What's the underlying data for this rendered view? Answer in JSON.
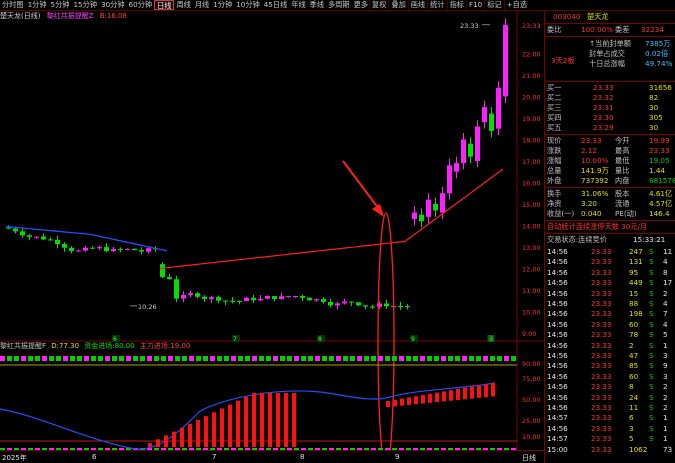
{
  "toolbar": {
    "left_items": [
      "分时图",
      "1分钟",
      "5分钟",
      "15分钟",
      "30分钟",
      "60分钟",
      "日线",
      "周线",
      "月线",
      "1分钟",
      "10分钟",
      "45日线",
      "年线",
      "季线",
      "多周期",
      "更多"
    ],
    "active_index": 6,
    "right_items": [
      "复权",
      "叠加",
      "画线",
      "统计",
      "指标",
      "F10",
      "标记",
      "+自选"
    ]
  },
  "chart_title": {
    "name": "楚天龙(日线)",
    "indicator": "黎红共振提醒Z",
    "value_label": "B:",
    "value": "16.08"
  },
  "price_axis": [
    "23.33",
    "22.00",
    "21.00",
    "20.00",
    "19.00",
    "18.00",
    "17.00",
    "16.00",
    "15.00",
    "14.00",
    "13.00",
    "12.00",
    "11.00",
    "10.00",
    "9.00"
  ],
  "high_label": "23.33",
  "low_label": "10.26",
  "period_markers": [
    "6",
    "7",
    "8",
    "9",
    "涨"
  ],
  "indicator_title": {
    "name": "黎红共振提醒F",
    "d_label": "D:",
    "d_value": "77.30",
    "s1_label": "资金进场:",
    "s1_value": "80.00",
    "s2_label": "主力进场:",
    "s2_value": "19.00"
  },
  "indicator_axis": [
    "90.00",
    "75.00",
    "50.00",
    "25.00",
    "10.00"
  ],
  "bottom_bar": {
    "date": "2025年",
    "markers": [
      "6",
      "7",
      "8",
      "9"
    ],
    "right": "日线"
  },
  "panel": {
    "code": "003040",
    "name": "楚天龙",
    "weibi_label": "委比",
    "weibi_value": "100.00%",
    "weicha_label": "委差",
    "weicha_value": "32234",
    "limit_status": "3天2板",
    "seal_info": [
      {
        "label": "↑当前封单额",
        "value": "7385万"
      },
      {
        "label": "封单占成交",
        "value": "0.02倍"
      },
      {
        "label": "十日总涨幅",
        "value": "49.74%"
      }
    ],
    "sell": [
      {
        "label": "卖五",
        "price": "",
        "vol": ""
      },
      {
        "label": "卖四",
        "price": "",
        "vol": ""
      },
      {
        "label": "卖三",
        "price": "",
        "vol": ""
      },
      {
        "label": "卖二",
        "price": "",
        "vol": ""
      },
      {
        "label": "卖一",
        "price": "",
        "vol": ""
      }
    ],
    "buy": [
      {
        "label": "买一",
        "price": "23.33",
        "vol": "31656"
      },
      {
        "label": "买二",
        "price": "23.32",
        "vol": "82"
      },
      {
        "label": "买三",
        "price": "23.31",
        "vol": "30"
      },
      {
        "label": "买四",
        "price": "23.30",
        "vol": "305"
      },
      {
        "label": "买五",
        "price": "23.29",
        "vol": "30"
      }
    ],
    "quote": [
      {
        "l1": "现价",
        "v1": "23.33",
        "l2": "今开",
        "v2": "19.99"
      },
      {
        "l1": "涨跌",
        "v1": "2.12",
        "l2": "最高",
        "v2": "23.33"
      },
      {
        "l1": "涨幅",
        "v1": "10.00%",
        "l2": "最低",
        "v2": "19.05"
      },
      {
        "l1": "总量",
        "v1": "141.9万",
        "l2": "量比",
        "v2": "1.44"
      },
      {
        "l1": "外盘",
        "v1": "737392",
        "l2": "内盘",
        "v2": "681578"
      }
    ],
    "finance": [
      {
        "l1": "换手",
        "v1": "31.06%",
        "l2": "股本",
        "v2": "4.61亿"
      },
      {
        "l1": "净资",
        "v1": "3.20",
        "l2": "流通",
        "v2": "4.57亿"
      },
      {
        "l1": "收益(一)",
        "v1": "0.040",
        "l2": "PE(动)",
        "v2": "146.4"
      }
    ],
    "promo": "自动统计连续涨停天数  30元/月",
    "trade_header": "交易状态:连续竞价",
    "trade_time": "15:33:21",
    "ticks": [
      {
        "t": "14:56",
        "p": "23.33",
        "v": "247",
        "d": "S",
        "n": "11"
      },
      {
        "t": "14:56",
        "p": "23.33",
        "v": "131",
        "d": "S",
        "n": "4"
      },
      {
        "t": "14:56",
        "p": "23.33",
        "v": "95",
        "d": "S",
        "n": "8"
      },
      {
        "t": "14:56",
        "p": "23.33",
        "v": "449",
        "d": "S",
        "n": "17"
      },
      {
        "t": "14:56",
        "p": "23.33",
        "v": "15",
        "d": "S",
        "n": "2"
      },
      {
        "t": "14:56",
        "p": "23.33",
        "v": "88",
        "d": "S",
        "n": "4"
      },
      {
        "t": "14:56",
        "p": "23.33",
        "v": "198",
        "d": "S",
        "n": "7"
      },
      {
        "t": "14:56",
        "p": "23.33",
        "v": "60",
        "d": "S",
        "n": "4"
      },
      {
        "t": "14:56",
        "p": "23.33",
        "v": "78",
        "d": "S",
        "n": "5"
      },
      {
        "t": "14:56",
        "p": "23.33",
        "v": "2",
        "d": "S",
        "n": "1"
      },
      {
        "t": "14:56",
        "p": "23.33",
        "v": "47",
        "d": "S",
        "n": "3"
      },
      {
        "t": "14:56",
        "p": "23.33",
        "v": "85",
        "d": "S",
        "n": "9"
      },
      {
        "t": "14:56",
        "p": "23.33",
        "v": "60",
        "d": "S",
        "n": "3"
      },
      {
        "t": "14:56",
        "p": "23.33",
        "v": "8",
        "d": "S",
        "n": "2"
      },
      {
        "t": "14:56",
        "p": "23.33",
        "v": "24",
        "d": "S",
        "n": "2"
      },
      {
        "t": "14:56",
        "p": "23.33",
        "v": "11",
        "d": "S",
        "n": "2"
      },
      {
        "t": "14:57",
        "p": "23.33",
        "v": "6",
        "d": "S",
        "n": "1"
      },
      {
        "t": "14:56",
        "p": "23.33",
        "v": "3",
        "d": "S",
        "n": "1"
      },
      {
        "t": "14:57",
        "p": "23.33",
        "v": "5",
        "d": "S",
        "n": "1"
      },
      {
        "t": "15:00",
        "p": "23.33",
        "v": "1062",
        "d": "",
        "n": "73"
      }
    ]
  },
  "colors": {
    "bg": "#000000",
    "up": "#ff3030",
    "candle": "#ff20ff",
    "down": "#00e000",
    "ma_blue": "#2050ff",
    "ma_red": "#ff2020"
  }
}
